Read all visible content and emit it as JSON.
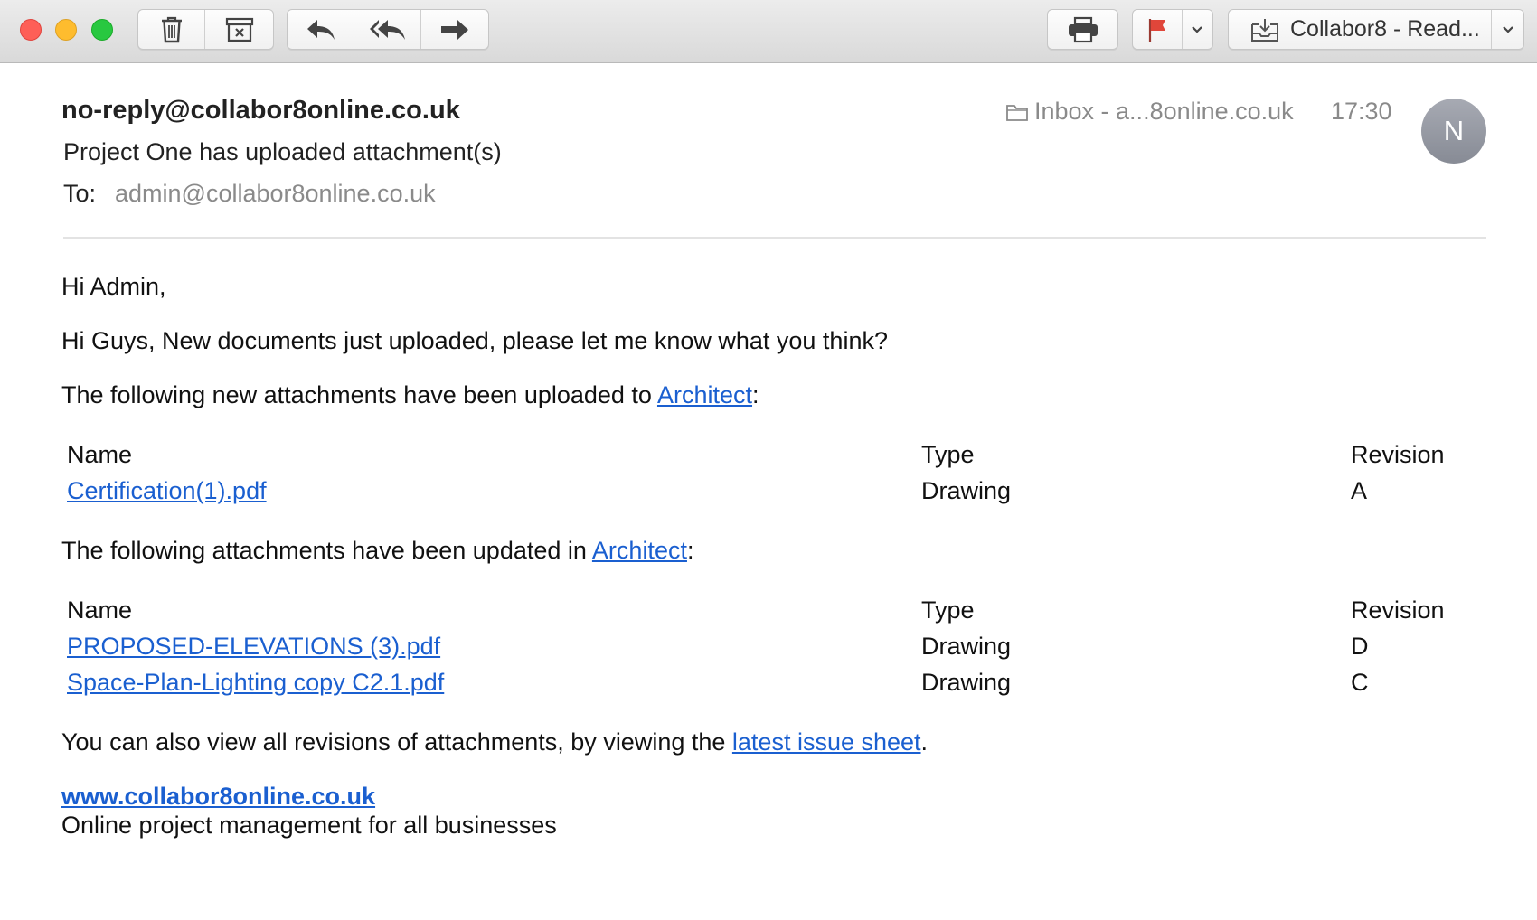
{
  "window": {
    "mailbox_title": "Collabor8 - Read..."
  },
  "toolbar": {
    "icons": [
      "trash-icon",
      "archive-icon",
      "reply-icon",
      "reply-all-icon",
      "forward-icon",
      "print-icon",
      "flag-icon",
      "chevron-down-icon",
      "move-to-mailbox-icon"
    ],
    "flag_color": "#e0463a"
  },
  "message": {
    "from": "no-reply@collabor8online.co.uk",
    "subject": "Project One has uploaded attachment(s)",
    "to_label": "To:",
    "to": "admin@collabor8online.co.uk",
    "mailbox": "Inbox - a...8online.co.uk",
    "time": "17:30",
    "avatar_initial": "N"
  },
  "body": {
    "greeting": "Hi Admin,",
    "note": "Hi Guys, New documents just uploaded, please let me know what you think?",
    "new_intro_before": "The following new attachments have been uploaded to ",
    "new_intro_link": "Architect",
    "new_intro_after": ":",
    "table_headers": {
      "name": "Name",
      "type": "Type",
      "revision": "Revision"
    },
    "new_attachments": [
      {
        "name": "Certification(1).pdf",
        "type": "Drawing",
        "revision": "A"
      }
    ],
    "updated_intro_before": "The following attachments have been updated in ",
    "updated_intro_link": "Architect",
    "updated_intro_after": ":",
    "updated_attachments": [
      {
        "name": "PROPOSED-ELEVATIONS (3).pdf",
        "type": "Drawing",
        "revision": "D"
      },
      {
        "name": "Space-Plan-Lighting copy C2.1.pdf",
        "type": "Drawing",
        "revision": "C"
      }
    ],
    "revisions_before": "You can also view all revisions of attachments, by viewing the ",
    "revisions_link": "latest issue sheet",
    "revisions_after": ".",
    "footer_link": "www.collabor8online.co.uk",
    "footer_tagline": "Online project management for all businesses",
    "link_color": "#1a5fd0"
  }
}
